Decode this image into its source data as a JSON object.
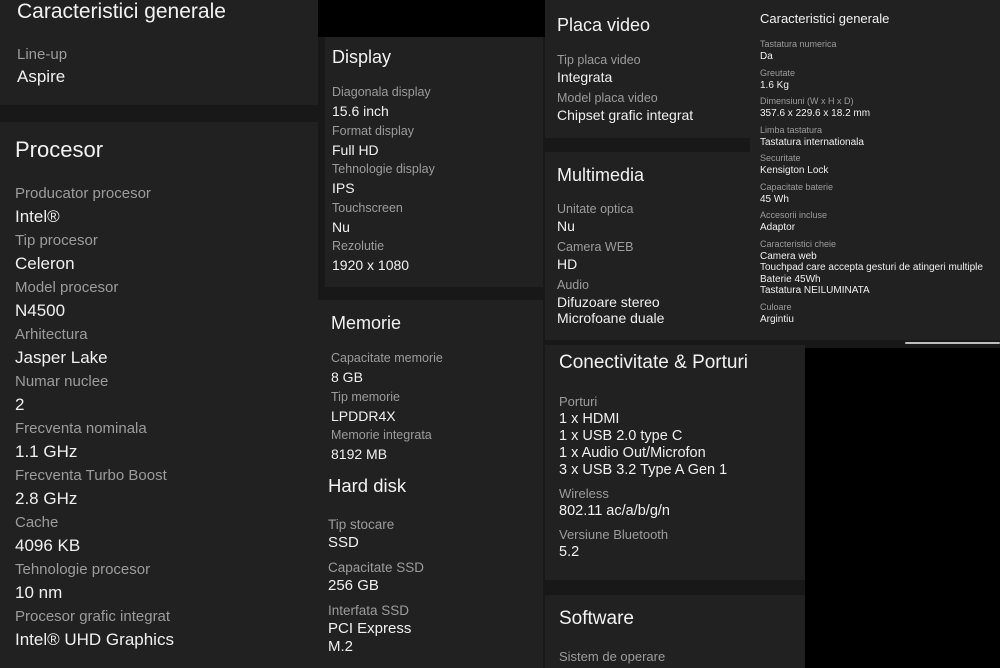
{
  "sections": [
    {
      "id": "s-gen1",
      "title": "Caracteristici generale",
      "specs": [
        {
          "label": "Line-up",
          "value": [
            "Aspire"
          ]
        }
      ]
    },
    {
      "id": "s-proc",
      "title": "Procesor",
      "specs": [
        {
          "label": "Producator procesor",
          "value": [
            "Intel®"
          ]
        },
        {
          "label": "Tip procesor",
          "value": [
            "Celeron"
          ]
        },
        {
          "label": "Model procesor",
          "value": [
            "N4500"
          ]
        },
        {
          "label": "Arhitectura",
          "value": [
            "Jasper Lake"
          ]
        },
        {
          "label": "Numar nuclee",
          "value": [
            "2"
          ]
        },
        {
          "label": "Frecventa nominala",
          "value": [
            "1.1 GHz"
          ]
        },
        {
          "label": "Frecventa Turbo Boost",
          "value": [
            "2.8 GHz"
          ]
        },
        {
          "label": "Cache",
          "value": [
            "4096 KB"
          ]
        },
        {
          "label": "Tehnologie procesor",
          "value": [
            "10 nm"
          ]
        },
        {
          "label": "Procesor grafic integrat",
          "value": [
            "Intel® UHD Graphics"
          ]
        }
      ]
    },
    {
      "id": "s-disp",
      "title": "Display",
      "specs": [
        {
          "label": "Diagonala display",
          "value": [
            "15.6 inch"
          ]
        },
        {
          "label": "Format display",
          "value": [
            "Full HD"
          ]
        },
        {
          "label": "Tehnologie display",
          "value": [
            "IPS"
          ]
        },
        {
          "label": "Touchscreen",
          "value": [
            "Nu"
          ]
        },
        {
          "label": "Rezolutie",
          "value": [
            "1920 x 1080"
          ]
        }
      ]
    },
    {
      "id": "s-mem",
      "title": "Memorie",
      "specs": [
        {
          "label": "Capacitate memorie",
          "value": [
            "8 GB"
          ]
        },
        {
          "label": "Tip memorie",
          "value": [
            "LPDDR4X"
          ]
        },
        {
          "label": "Memorie integrata",
          "value": [
            "8192 MB"
          ]
        }
      ]
    },
    {
      "id": "s-hdd",
      "title": "Hard disk",
      "specs": [
        {
          "label": "Tip stocare",
          "value": [
            "SSD"
          ]
        },
        {
          "label": "Capacitate SSD",
          "value": [
            "256 GB"
          ]
        },
        {
          "label": "Interfata SSD",
          "value": [
            "PCI Express",
            "M.2"
          ]
        }
      ]
    },
    {
      "id": "s-placa",
      "title": "Placa video",
      "specs": [
        {
          "label": "Tip placa video",
          "value": [
            "Integrata"
          ]
        },
        {
          "label": "Model placa video",
          "value": [
            "Chipset grafic integrat"
          ]
        }
      ]
    },
    {
      "id": "s-mm",
      "title": "Multimedia",
      "specs": [
        {
          "label": "Unitate optica",
          "value": [
            "Nu"
          ]
        },
        {
          "label": "Camera WEB",
          "value": [
            "HD"
          ]
        },
        {
          "label": "Audio",
          "value": [
            "Difuzoare stereo",
            "Microfoane duale"
          ]
        }
      ]
    },
    {
      "id": "s-con",
      "title": "Conectivitate & Porturi",
      "specs": [
        {
          "label": "Porturi",
          "value": [
            "1 x HDMI",
            "1 x USB 2.0 type C",
            "1 x Audio Out/Microfon",
            "3 x USB 3.2 Type A Gen 1"
          ]
        },
        {
          "label": "Wireless",
          "value": [
            "802.11 ac/a/b/g/n"
          ]
        },
        {
          "label": "Versiune Bluetooth",
          "value": [
            "5.2"
          ]
        }
      ]
    },
    {
      "id": "s-soft",
      "title": "Software",
      "specs": [
        {
          "label": "Sistem de operare",
          "value": []
        }
      ]
    },
    {
      "id": "s-gen2",
      "title": "Caracteristici generale",
      "specs": [
        {
          "label": "Tastatura numerica",
          "value": [
            "Da"
          ]
        },
        {
          "label": "Greutate",
          "value": [
            "1.6 Kg"
          ]
        },
        {
          "label": "Dimensiuni (W x H x D)",
          "value": [
            "357.6 x 229.6 x 18.2 mm"
          ]
        },
        {
          "label": "Limba tastatura",
          "value": [
            "Tastatura internationala"
          ]
        },
        {
          "label": "Securitate",
          "value": [
            "Kensigton Lock"
          ]
        },
        {
          "label": "Capacitate baterie",
          "value": [
            "45 Wh"
          ]
        },
        {
          "label": "Accesorii incluse",
          "value": [
            "Adaptor"
          ]
        },
        {
          "label": "Caracteristici cheie",
          "value": [
            "Camera web",
            "Touchpad care accepta gesturi de atingeri multiple",
            "Baterie 45Wh",
            "Tastatura NEILUMINATA"
          ]
        },
        {
          "label": "Culoare",
          "value": [
            "Argintiu"
          ]
        }
      ]
    }
  ]
}
